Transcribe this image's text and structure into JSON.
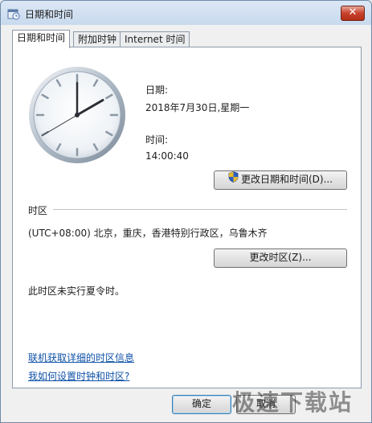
{
  "window": {
    "title": "日期和时间"
  },
  "tabs": [
    "日期和时间",
    "附加时钟",
    "Internet 时间"
  ],
  "date_time": {
    "date_label": "日期:",
    "date_value": "2018年7月30日,星期一",
    "time_label": "时间:",
    "time_value": "14:00:40",
    "change_button": "更改日期和时间(D)..."
  },
  "timezone": {
    "section_label": "时区",
    "value": "(UTC+08:00) 北京，重庆，香港特别行政区，乌鲁木齐",
    "change_button": "更改时区(Z)...",
    "dst_note": "此时区未实行夏令时。"
  },
  "links": {
    "online_info": "联机获取详细的时区信息",
    "how_to": "我如何设置时钟和时区?"
  },
  "buttons": {
    "ok": "确定",
    "cancel": "取消"
  },
  "watermark": "极速下载站",
  "colors": {
    "link": "#0f52a8",
    "close_button": "#c7412c"
  }
}
